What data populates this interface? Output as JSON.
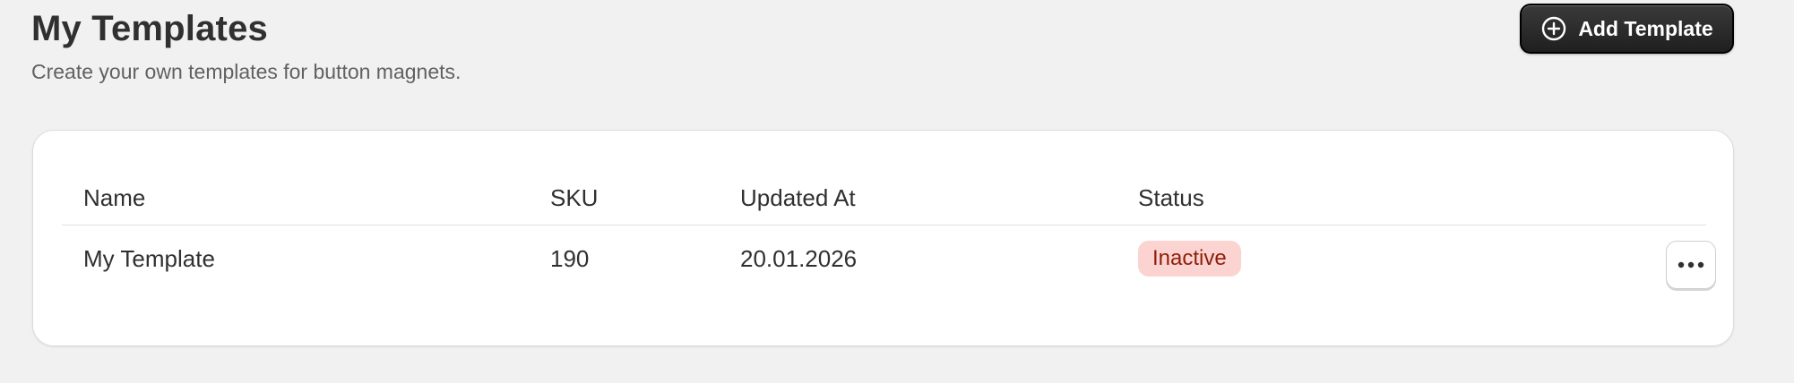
{
  "header": {
    "title": "My Templates",
    "subtitle": "Create your own templates for button magnets.",
    "add_button_label": "Add Template",
    "add_button_icon": "plus-circle-icon"
  },
  "table": {
    "columns": [
      "Name",
      "SKU",
      "Updated At",
      "Status"
    ],
    "rows": [
      {
        "name": "My Template",
        "sku": "190",
        "updated_at": "20.01.2026",
        "status": "Inactive",
        "actions_icon": "more-horizontal-icon"
      }
    ]
  },
  "colors": {
    "page_background": "#f1f1f1",
    "primary_button": "#303030",
    "status_inactive_bg": "#fbd3d1",
    "status_inactive_text": "#8e1f0b"
  }
}
